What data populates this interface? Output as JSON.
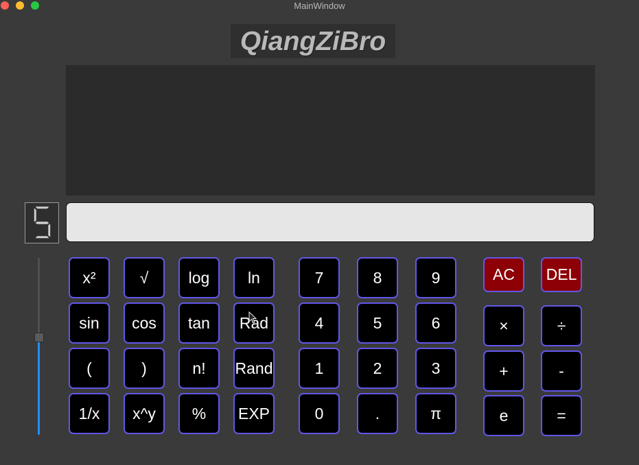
{
  "window": {
    "title": "MainWindow"
  },
  "brand": {
    "text": "QiangZiBro"
  },
  "lcd": {
    "digit": "5"
  },
  "entry": {
    "value": ""
  },
  "slider": {
    "value_fraction": 0.54
  },
  "sci_buttons": [
    [
      "x²",
      "√",
      "log",
      "ln"
    ],
    [
      "sin",
      "cos",
      "tan",
      "Rad"
    ],
    [
      "(",
      ")",
      "n!",
      "Rand"
    ],
    [
      "1/x",
      "x^y",
      "%",
      "EXP"
    ]
  ],
  "num_buttons": [
    [
      "7",
      "8",
      "9"
    ],
    [
      "4",
      "5",
      "6"
    ],
    [
      "1",
      "2",
      "3"
    ],
    [
      "0",
      ".",
      "π"
    ]
  ],
  "op_buttons": {
    "ac": "AC",
    "del": "DEL",
    "multiply": "×",
    "divide": "÷",
    "plus": "+",
    "minus": "-",
    "e": "e",
    "equals": "="
  },
  "colors": {
    "button_border": "#6157e8",
    "button_bg": "#000000",
    "danger_bg": "#8c0006",
    "slider_accent": "#1e90ff"
  }
}
